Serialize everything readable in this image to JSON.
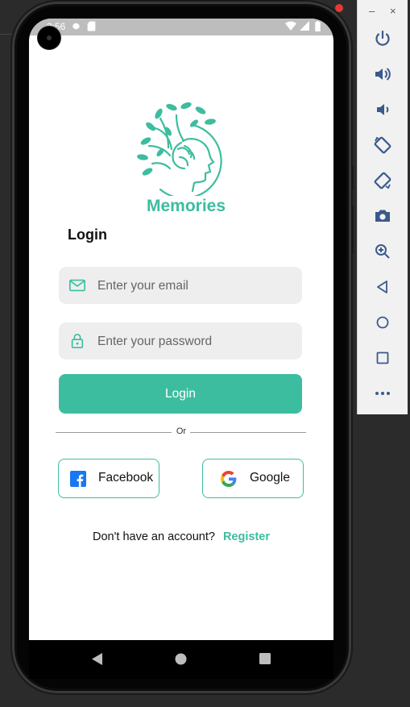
{
  "status_bar": {
    "time": "2:56"
  },
  "app": {
    "brand": "Memories",
    "title": "Login",
    "email": {
      "placeholder": "Enter your email",
      "value": ""
    },
    "password": {
      "placeholder": "Enter your password",
      "value": ""
    },
    "login_label": "Login",
    "divider_text": "Or",
    "facebook_label": "Facebook",
    "google_label": "Google",
    "no_account_text": "Don't have an account?",
    "register_label": "Register"
  },
  "colors": {
    "accent": "#3dbd9f",
    "field_bg": "#eeeeee"
  },
  "emulator_panel": {
    "window_controls": [
      "–",
      "×"
    ],
    "tools": [
      "power-icon",
      "volume-up-icon",
      "volume-down-icon",
      "rotate-left-icon",
      "rotate-right-icon",
      "camera-icon",
      "zoom-icon",
      "back-icon",
      "home-icon",
      "overview-icon",
      "more-icon"
    ]
  }
}
